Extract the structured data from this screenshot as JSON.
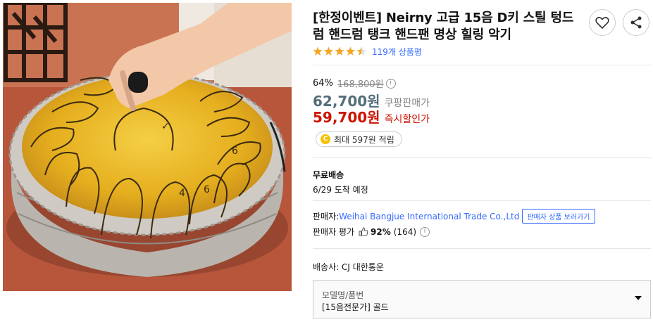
{
  "product": {
    "title": "[한정이벤트] Neirny 고급 15음 D키 스틸 텅드럼 핸드럼 탱크 핸드팬 명상 힐링 악기",
    "rating": 4.5,
    "review_count": "119개 상품평",
    "discount_rate": "64%",
    "original_price": "168,800원",
    "price": "62,700원",
    "price_label": "쿠팡판매가",
    "sale_price": "59,700원",
    "sale_label": "즉시할인가",
    "cashback": "최대 597원 적립",
    "coin_icon": "C"
  },
  "shipping": {
    "title": "무료배송",
    "date": "6/29 도착 예정"
  },
  "seller": {
    "label": "판매자: ",
    "name": "Weihai Bangjue International Trade Co.,Ltd",
    "button": "판매자 상품 보러가기",
    "eval_label": "판매자 평가",
    "eval_value": "92%",
    "eval_count": "(164)"
  },
  "delivery": {
    "carrier": "배송사: CJ 대한통운"
  },
  "option": {
    "label": "모델명/품번",
    "value": "[15음전문가] 골드"
  },
  "colors": {
    "accent_blue": "#346aff",
    "sale_red": "#cb1400",
    "star": "#f5a623",
    "price_gray": "#546e7a"
  }
}
